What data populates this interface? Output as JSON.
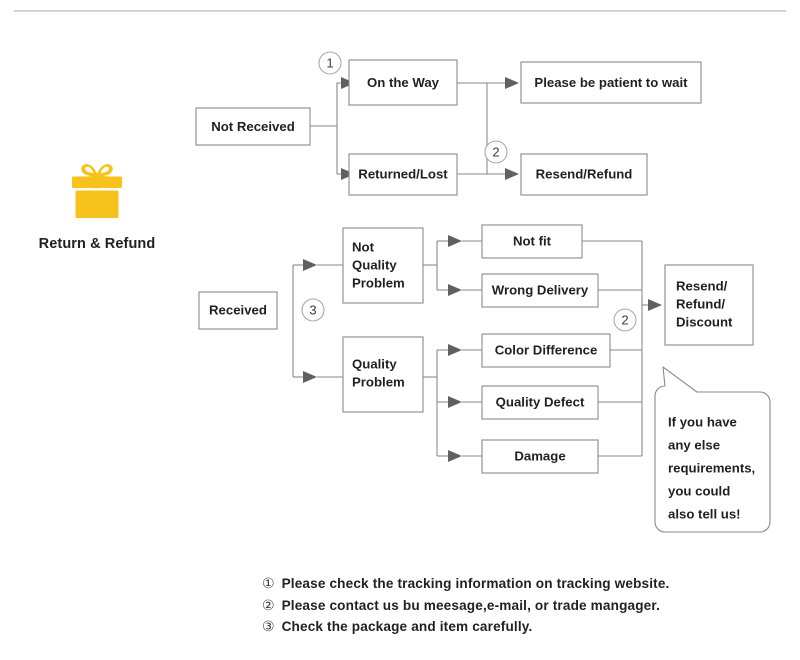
{
  "page": {
    "title": "Return & Refund",
    "divider": true,
    "colors": {
      "gift_icon": "#f7c21b",
      "box_stroke": "#8a8a8a",
      "arrow": "#5e6063",
      "text": "#231f20"
    }
  },
  "brand": {
    "icon": "gift-icon",
    "label": "Return & Refund"
  },
  "flow": {
    "branch_not_received": {
      "root": "Not Received",
      "children": [
        {
          "label": "On the Way",
          "marker": "1",
          "outcome": "Please be patient to wait"
        },
        {
          "label": "Returned/Lost",
          "marker": "2",
          "outcome": "Resend/Refund"
        }
      ]
    },
    "branch_received": {
      "root": "Received",
      "marker": "3",
      "groups": [
        {
          "label": "Not Quality Problem",
          "lines": [
            "Not",
            "Quality",
            "Problem"
          ],
          "reasons": [
            "Not fit",
            "Wrong Delivery"
          ]
        },
        {
          "label": "Quality Problem",
          "lines": [
            "Quality",
            "Problem"
          ],
          "reasons": [
            "Color Difference",
            "Quality Defect",
            "Damage"
          ]
        }
      ],
      "outcome": {
        "marker": "2",
        "lines": [
          "Resend/",
          "Refund/",
          "Discount"
        ]
      }
    },
    "bubble": {
      "lines": [
        "If you have",
        "any else",
        "requirements,",
        "you could",
        "also tell us!"
      ]
    }
  },
  "notes": [
    {
      "marker": "①",
      "text": "Please check the tracking information on tracking website."
    },
    {
      "marker": "②",
      "text": "Please contact us bu meesage,e-mail, or trade mangager."
    },
    {
      "marker": "③",
      "text": "Check the package and item carefully."
    }
  ]
}
